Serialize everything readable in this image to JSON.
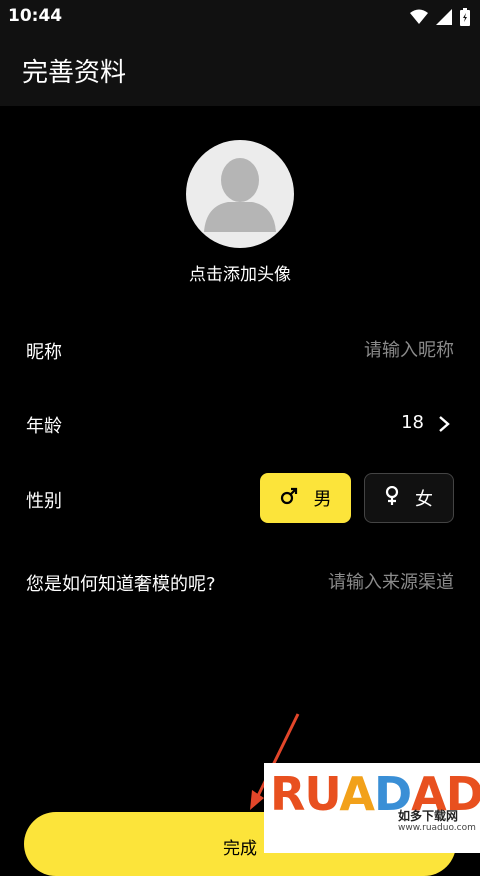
{
  "status_bar": {
    "time": "10:44"
  },
  "header": {
    "title": "完善资料"
  },
  "avatar": {
    "caption": "点击添加头像"
  },
  "nickname": {
    "label": "昵称",
    "placeholder": "请输入昵称"
  },
  "age": {
    "label": "年龄",
    "value": "18"
  },
  "gender": {
    "label": "性别",
    "male_label": "男",
    "female_label": "女",
    "selected": "男"
  },
  "source": {
    "label": "您是如何知道奢模的呢?",
    "placeholder": "请输入来源渠道"
  },
  "done_button": {
    "label": "完成"
  },
  "watermark": {
    "logo": "RUANDADO",
    "subtitle": "如多下载网",
    "url": "www.ruaduo.com"
  },
  "colors": {
    "accent": "#fce43a",
    "background": "#000000",
    "bar": "#111111",
    "placeholder": "#8a8a8a",
    "annotation": "#e2462a"
  }
}
